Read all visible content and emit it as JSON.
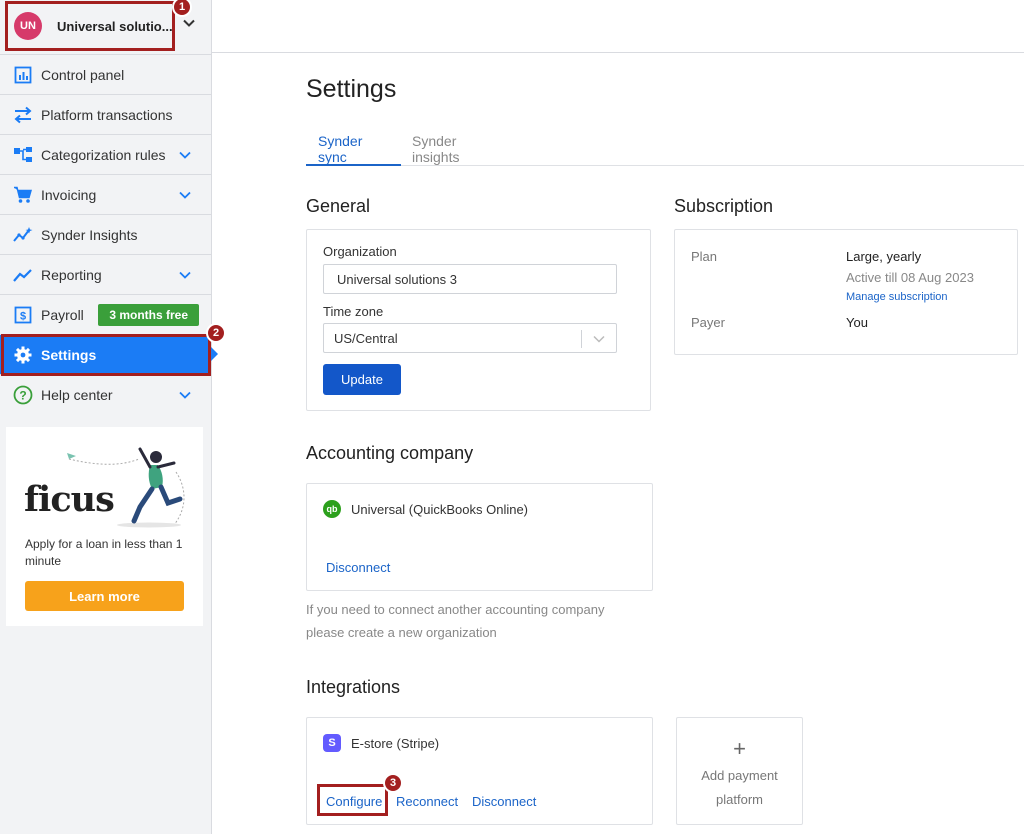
{
  "sidebar": {
    "org": {
      "initials": "UN",
      "name": "Universal solutio..."
    },
    "nav": [
      {
        "label": "Control panel"
      },
      {
        "label": "Platform transactions"
      },
      {
        "label": "Categorization rules"
      },
      {
        "label": "Invoicing"
      },
      {
        "label": "Synder Insights"
      },
      {
        "label": "Reporting"
      },
      {
        "label": "Payroll",
        "promo": "3 months free"
      },
      {
        "label": "Settings"
      },
      {
        "label": "Help center"
      }
    ],
    "promo": {
      "logo": "ficus",
      "text": "Apply for a loan in less than 1 minute",
      "button": "Learn more"
    }
  },
  "callouts": [
    "1",
    "2",
    "3"
  ],
  "main": {
    "title": "Settings",
    "tabs": [
      {
        "label": "Synder sync"
      },
      {
        "label": "Synder insights"
      }
    ],
    "general": {
      "title": "General",
      "organization_label": "Organization",
      "organization_value": "Universal solutions 3",
      "timezone_label": "Time zone",
      "timezone_value": "US/Central",
      "update_button": "Update"
    },
    "subscription": {
      "title": "Subscription",
      "plan_label": "Plan",
      "plan_value": "Large, yearly",
      "plan_status": "Active till 08 Aug 2023",
      "manage_link": "Manage subscription",
      "payer_label": "Payer",
      "payer_value": "You"
    },
    "accounting": {
      "title": "Accounting company",
      "icon_text": "qb",
      "company": "Universal (QuickBooks Online)",
      "disconnect": "Disconnect",
      "note_line1": "If you need to connect another accounting company",
      "note_line2": "please create a new organization"
    },
    "integrations": {
      "title": "Integrations",
      "icon_text": "S",
      "store": "E-store (Stripe)",
      "configure": "Configure",
      "reconnect": "Reconnect",
      "disconnect": "Disconnect",
      "add_plus": "+",
      "add_line1": "Add payment",
      "add_line2": "platform"
    }
  },
  "colors": {
    "accent": "#1b7cf5",
    "primary_button": "#1357c9",
    "link": "#1b64c8",
    "callout": "#a31f1f",
    "promo_green": "#3a9f3a",
    "ficus_orange": "#f7a21b"
  }
}
